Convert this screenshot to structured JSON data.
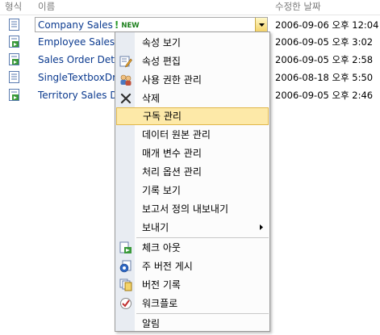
{
  "columns": {
    "type": "형식",
    "name": "이름",
    "modified": "수정한 날짜"
  },
  "rows": [
    {
      "name": "Company Sales",
      "badge": "NEW",
      "date": "2006-09-06 오후 12:04"
    },
    {
      "name": "Employee Sales",
      "date": "2006-09-05 오후 3:02"
    },
    {
      "name": "Sales Order Deta",
      "date": "2006-09-05 오후 2:58"
    },
    {
      "name": "SingleTextboxDr",
      "date": "2006-08-18 오후 5:50"
    },
    {
      "name": "Territory Sales D",
      "date": "2006-09-05 오후 2:46"
    }
  ],
  "menu": {
    "items": [
      {
        "label": "속성 보기",
        "icon": "none"
      },
      {
        "label": "속성 편집",
        "icon": "edit-properties-icon"
      },
      {
        "label": "사용 권한 관리",
        "icon": "permissions-icon"
      },
      {
        "label": "삭제",
        "icon": "delete-x-icon"
      },
      {
        "label": "구독 관리",
        "icon": "none",
        "highlighted": true
      },
      {
        "label": "데이터 원본 관리",
        "icon": "none"
      },
      {
        "label": "매개 변수 관리",
        "icon": "none"
      },
      {
        "label": "처리 옵션 관리",
        "icon": "none"
      },
      {
        "label": "기록 보기",
        "icon": "none"
      },
      {
        "label": "보고서 정의 내보내기",
        "icon": "none"
      },
      {
        "label": "보내기",
        "icon": "none",
        "submenu": true
      },
      {
        "label": "체크 아웃",
        "icon": "check-out-icon"
      },
      {
        "label": "주 버전 게시",
        "icon": "publish-icon"
      },
      {
        "label": "버전 기록",
        "icon": "version-history-icon"
      },
      {
        "label": "워크플로",
        "icon": "workflow-icon"
      },
      {
        "label": "알림",
        "icon": "none"
      }
    ]
  },
  "colors": {
    "link": "#0b3a8f",
    "highlight": "#fde9a8",
    "highlight_border": "#e0b64a",
    "header_text": "#7a7a7a"
  }
}
